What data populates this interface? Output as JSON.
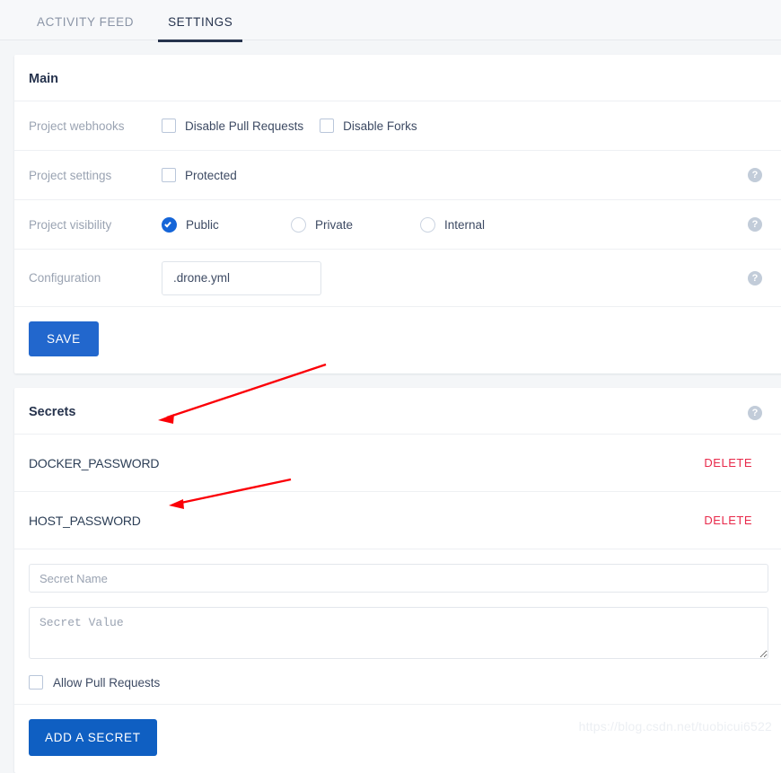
{
  "tabs": [
    {
      "label": "ACTIVITY FEED",
      "active": false
    },
    {
      "label": "SETTINGS",
      "active": true
    }
  ],
  "main": {
    "title": "Main",
    "rows": {
      "webhooks": {
        "label": "Project webhooks",
        "options": [
          {
            "label": "Disable Pull Requests",
            "checked": false
          },
          {
            "label": "Disable Forks",
            "checked": false
          }
        ]
      },
      "settings": {
        "label": "Project settings",
        "options": [
          {
            "label": "Protected",
            "checked": false
          }
        ],
        "help": "?"
      },
      "visibility": {
        "label": "Project visibility",
        "options": [
          {
            "label": "Public",
            "checked": true
          },
          {
            "label": "Private",
            "checked": false
          },
          {
            "label": "Internal",
            "checked": false
          }
        ],
        "help": "?"
      },
      "configuration": {
        "label": "Configuration",
        "value": ".drone.yml",
        "placeholder": ".drone.yml",
        "help": "?"
      }
    },
    "save_label": "SAVE"
  },
  "secrets": {
    "title": "Secrets",
    "help": "?",
    "items": [
      {
        "name": "DOCKER_PASSWORD",
        "delete_label": "DELETE"
      },
      {
        "name": "HOST_PASSWORD",
        "delete_label": "DELETE"
      }
    ],
    "new_secret": {
      "name_value": "",
      "name_placeholder": "Secret Name",
      "value_value": "",
      "value_placeholder": "Secret Value",
      "allow_pr_label": "Allow Pull Requests",
      "allow_pr_checked": false,
      "add_label": "ADD A SECRET"
    }
  },
  "watermark": "https://blog.csdn.net/tuobicui6522",
  "colors": {
    "accent_blue": "#1565d8",
    "save_blue": "#2267cd",
    "add_blue": "#0f5fc2",
    "delete_red": "#e8294a",
    "annotation_red": "#fb0007",
    "tab_active": "#26334d",
    "label_grey": "#9aa3b2"
  }
}
